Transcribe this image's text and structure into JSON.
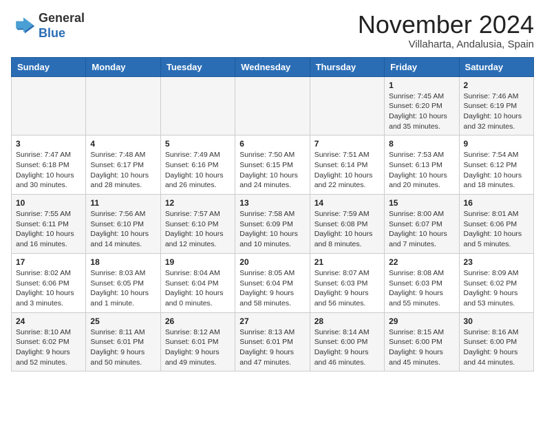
{
  "header": {
    "logo_line1": "General",
    "logo_line2": "Blue",
    "month": "November 2024",
    "location": "Villaharta, Andalusia, Spain"
  },
  "weekdays": [
    "Sunday",
    "Monday",
    "Tuesday",
    "Wednesday",
    "Thursday",
    "Friday",
    "Saturday"
  ],
  "weeks": [
    [
      {
        "day": "",
        "info": ""
      },
      {
        "day": "",
        "info": ""
      },
      {
        "day": "",
        "info": ""
      },
      {
        "day": "",
        "info": ""
      },
      {
        "day": "",
        "info": ""
      },
      {
        "day": "1",
        "info": "Sunrise: 7:45 AM\nSunset: 6:20 PM\nDaylight: 10 hours and 35 minutes."
      },
      {
        "day": "2",
        "info": "Sunrise: 7:46 AM\nSunset: 6:19 PM\nDaylight: 10 hours and 32 minutes."
      }
    ],
    [
      {
        "day": "3",
        "info": "Sunrise: 7:47 AM\nSunset: 6:18 PM\nDaylight: 10 hours and 30 minutes."
      },
      {
        "day": "4",
        "info": "Sunrise: 7:48 AM\nSunset: 6:17 PM\nDaylight: 10 hours and 28 minutes."
      },
      {
        "day": "5",
        "info": "Sunrise: 7:49 AM\nSunset: 6:16 PM\nDaylight: 10 hours and 26 minutes."
      },
      {
        "day": "6",
        "info": "Sunrise: 7:50 AM\nSunset: 6:15 PM\nDaylight: 10 hours and 24 minutes."
      },
      {
        "day": "7",
        "info": "Sunrise: 7:51 AM\nSunset: 6:14 PM\nDaylight: 10 hours and 22 minutes."
      },
      {
        "day": "8",
        "info": "Sunrise: 7:53 AM\nSunset: 6:13 PM\nDaylight: 10 hours and 20 minutes."
      },
      {
        "day": "9",
        "info": "Sunrise: 7:54 AM\nSunset: 6:12 PM\nDaylight: 10 hours and 18 minutes."
      }
    ],
    [
      {
        "day": "10",
        "info": "Sunrise: 7:55 AM\nSunset: 6:11 PM\nDaylight: 10 hours and 16 minutes."
      },
      {
        "day": "11",
        "info": "Sunrise: 7:56 AM\nSunset: 6:10 PM\nDaylight: 10 hours and 14 minutes."
      },
      {
        "day": "12",
        "info": "Sunrise: 7:57 AM\nSunset: 6:10 PM\nDaylight: 10 hours and 12 minutes."
      },
      {
        "day": "13",
        "info": "Sunrise: 7:58 AM\nSunset: 6:09 PM\nDaylight: 10 hours and 10 minutes."
      },
      {
        "day": "14",
        "info": "Sunrise: 7:59 AM\nSunset: 6:08 PM\nDaylight: 10 hours and 8 minutes."
      },
      {
        "day": "15",
        "info": "Sunrise: 8:00 AM\nSunset: 6:07 PM\nDaylight: 10 hours and 7 minutes."
      },
      {
        "day": "16",
        "info": "Sunrise: 8:01 AM\nSunset: 6:06 PM\nDaylight: 10 hours and 5 minutes."
      }
    ],
    [
      {
        "day": "17",
        "info": "Sunrise: 8:02 AM\nSunset: 6:06 PM\nDaylight: 10 hours and 3 minutes."
      },
      {
        "day": "18",
        "info": "Sunrise: 8:03 AM\nSunset: 6:05 PM\nDaylight: 10 hours and 1 minute."
      },
      {
        "day": "19",
        "info": "Sunrise: 8:04 AM\nSunset: 6:04 PM\nDaylight: 10 hours and 0 minutes."
      },
      {
        "day": "20",
        "info": "Sunrise: 8:05 AM\nSunset: 6:04 PM\nDaylight: 9 hours and 58 minutes."
      },
      {
        "day": "21",
        "info": "Sunrise: 8:07 AM\nSunset: 6:03 PM\nDaylight: 9 hours and 56 minutes."
      },
      {
        "day": "22",
        "info": "Sunrise: 8:08 AM\nSunset: 6:03 PM\nDaylight: 9 hours and 55 minutes."
      },
      {
        "day": "23",
        "info": "Sunrise: 8:09 AM\nSunset: 6:02 PM\nDaylight: 9 hours and 53 minutes."
      }
    ],
    [
      {
        "day": "24",
        "info": "Sunrise: 8:10 AM\nSunset: 6:02 PM\nDaylight: 9 hours and 52 minutes."
      },
      {
        "day": "25",
        "info": "Sunrise: 8:11 AM\nSunset: 6:01 PM\nDaylight: 9 hours and 50 minutes."
      },
      {
        "day": "26",
        "info": "Sunrise: 8:12 AM\nSunset: 6:01 PM\nDaylight: 9 hours and 49 minutes."
      },
      {
        "day": "27",
        "info": "Sunrise: 8:13 AM\nSunset: 6:01 PM\nDaylight: 9 hours and 47 minutes."
      },
      {
        "day": "28",
        "info": "Sunrise: 8:14 AM\nSunset: 6:00 PM\nDaylight: 9 hours and 46 minutes."
      },
      {
        "day": "29",
        "info": "Sunrise: 8:15 AM\nSunset: 6:00 PM\nDaylight: 9 hours and 45 minutes."
      },
      {
        "day": "30",
        "info": "Sunrise: 8:16 AM\nSunset: 6:00 PM\nDaylight: 9 hours and 44 minutes."
      }
    ]
  ]
}
